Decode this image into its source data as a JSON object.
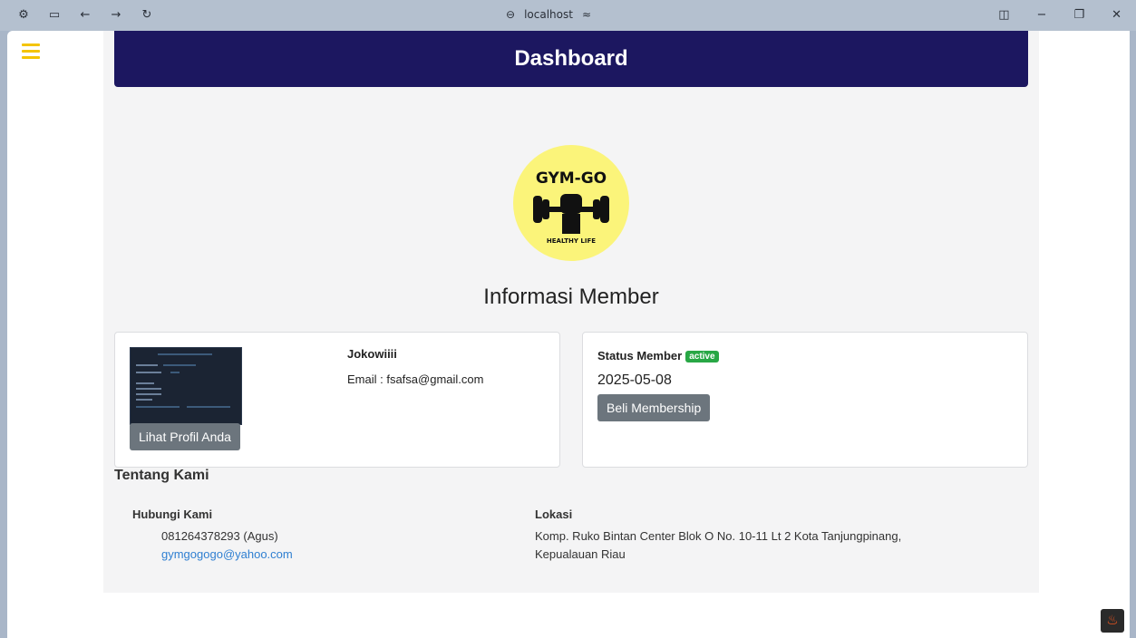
{
  "browser": {
    "address": "localhost"
  },
  "page": {
    "header_title": "Dashboard",
    "logo": {
      "top_text": "GYM-GO",
      "bottom_text": "HEALTHY LIFE"
    },
    "section_title": "Informasi Member",
    "profile_card": {
      "name": "Jokowiiii",
      "email": "Email : fsafsa@gmail.com",
      "profile_button": "Lihat Profil Anda"
    },
    "status_card": {
      "label": "Status Member",
      "badge": "active",
      "date": "2025-05-08",
      "buy_button": "Beli Membership"
    },
    "about": {
      "title": "Tentang Kami",
      "contact_title": "Hubungi Kami",
      "phone": "081264378293 (Agus)",
      "email": "gymgogogo@yahoo.com",
      "location_title": "Lokasi",
      "address_line1": "Komp. Ruko Bintan Center Blok O No. 10-11 Lt 2 Kota Tanjungpinang,",
      "address_line2": "Kepualauan Riau"
    }
  },
  "colors": {
    "header": "#1c1760",
    "hamburger": "#f4c400",
    "badge": "#28a745",
    "button": "#6c757d",
    "link": "#2f7fd1"
  },
  "icons": [
    "sidebar-toggle-icon",
    "back-icon",
    "forward-icon",
    "refresh-icon",
    "site-info-icon",
    "tune-icon",
    "split-view-icon",
    "minimize-icon",
    "restore-icon",
    "close-icon",
    "fire-icon"
  ]
}
